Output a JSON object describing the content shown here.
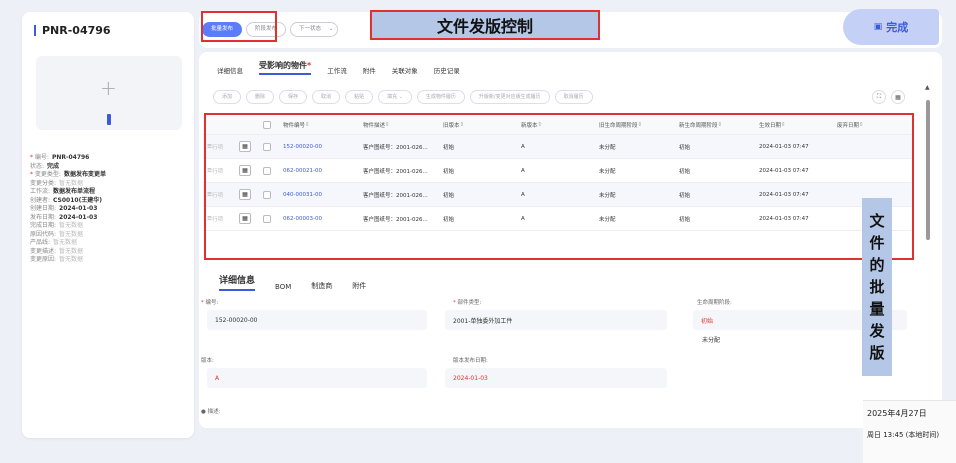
{
  "left_panel": {
    "title": "PNR-04796",
    "meta": [
      {
        "key": "编号:",
        "value": "PNR-04796",
        "required": true,
        "empty": false
      },
      {
        "key": "状态:",
        "value": "完成",
        "required": false,
        "empty": false
      },
      {
        "key": "变更类型:",
        "value": "数据发布变更单",
        "required": true,
        "empty": false
      },
      {
        "key": "变更分类:",
        "value": "暂无数据",
        "required": false,
        "empty": true
      },
      {
        "key": "工作流:",
        "value": "数据发布单流程",
        "required": false,
        "empty": false
      },
      {
        "key": "创建者:",
        "value": "CS0010(王建华)",
        "required": false,
        "empty": false
      },
      {
        "key": "创建日期:",
        "value": "2024-01-03",
        "required": false,
        "empty": false
      },
      {
        "key": "发布日期:",
        "value": "2024-01-03",
        "required": false,
        "empty": false
      },
      {
        "key": "完成日期:",
        "value": "暂无数据",
        "required": false,
        "empty": true
      },
      {
        "key": "原因代码:",
        "value": "暂无数据",
        "required": false,
        "empty": true
      },
      {
        "key": "产品线:",
        "value": "暂无数据",
        "required": false,
        "empty": true
      },
      {
        "key": "变更描述:",
        "value": "暂无数据",
        "required": false,
        "empty": true
      },
      {
        "key": "变更原因:",
        "value": "暂无数据",
        "required": false,
        "empty": true
      }
    ]
  },
  "topbar": {
    "batch_release": "批量发布",
    "phase_release": "阶段发布",
    "next_state": "下一状态",
    "finish": "完成"
  },
  "annotations": {
    "title": "文件发版控制",
    "side": [
      "文",
      "件",
      "的",
      "批",
      "量",
      "发",
      "版"
    ]
  },
  "main_tabs": {
    "tabs": [
      "详细信息",
      "受影响的物件",
      "工作流",
      "附件",
      "关联对象",
      "历史记录"
    ],
    "required_mark": "*"
  },
  "toolbar": [
    "添加",
    "删除",
    "保存",
    "取消",
    "粘贴",
    "填充",
    "生成物件履历",
    "升版新/变更对应版生成履历",
    "取消履历"
  ],
  "toolbar_dropdown_icon": "chevron-down-icon",
  "table": {
    "headers": [
      "物件编号",
      "物件描述",
      "旧版本",
      "新版本",
      "旧生命周期阶段",
      "新生命周期阶段",
      "生效日期",
      "废弃日期"
    ],
    "row_prefix": "行项",
    "rows": [
      [
        "152-00020-00",
        "客户图纸号：2001-026...",
        "初始",
        "A",
        "未分配",
        "初始",
        "2024-01-03 07:47",
        ""
      ],
      [
        "062-00021-00",
        "客户图纸号：2001-026...",
        "初始",
        "A",
        "未分配",
        "初始",
        "2024-01-03 07:47",
        ""
      ],
      [
        "040-00031-00",
        "客户图纸号：2001-026...",
        "初始",
        "A",
        "未分配",
        "初始",
        "2024-01-03 07:47",
        ""
      ],
      [
        "062-00003-00",
        "客户图纸号：2001-026...",
        "初始",
        "A",
        "未分配",
        "初始",
        "2024-01-03 07:47",
        ""
      ]
    ]
  },
  "detail": {
    "tabs": [
      "详细信息",
      "BOM",
      "制造商",
      "附件"
    ],
    "fields": {
      "number_label": "编号:",
      "number_value": "152-00020-00",
      "part_type_label": "部件类型:",
      "part_type_value": "2001-单独委外加工件",
      "lifecycle_label": "生命周期阶段:",
      "lifecycle_value_new": "初始",
      "lifecycle_value_old": "未分配",
      "version_label": "版本:",
      "version_value": "A",
      "release_date_label": "版本发布日期:",
      "release_date_value": "2024-01-03",
      "description_label": "描述:"
    }
  },
  "clock": {
    "date": "2025年4月27日",
    "time": "周日 13:45 (本地时间)"
  },
  "colors": {
    "accent": "#3b5bdb",
    "annotation_bg": "#b4c7e7",
    "annotation_border": "#e03131"
  }
}
